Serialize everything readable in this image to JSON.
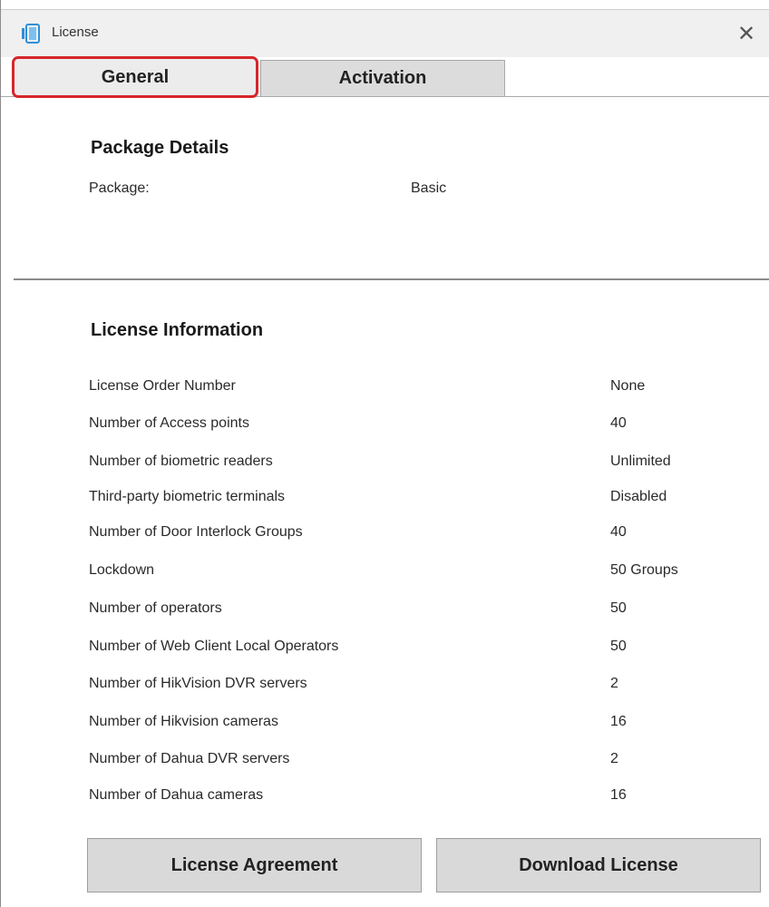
{
  "window": {
    "title": "License",
    "close_glyph": "✕"
  },
  "tabs": [
    {
      "label": "General",
      "selected": true
    },
    {
      "label": "Activation",
      "selected": false
    }
  ],
  "package": {
    "section_title": "Package Details",
    "package_label": "Package:",
    "package_value": "Basic"
  },
  "license": {
    "section_title": "License Information",
    "rows": [
      {
        "label": "License Order Number",
        "value": "None"
      },
      {
        "label": "Number of Access points",
        "value": "40"
      },
      {
        "label": "Number of biometric readers",
        "value": "Unlimited"
      },
      {
        "label": "Third-party biometric terminals",
        "value": "Disabled"
      },
      {
        "label": "Number of Door Interlock Groups",
        "value": "40"
      },
      {
        "label": "Lockdown",
        "value": "50 Groups"
      },
      {
        "label": "Number of operators",
        "value": "50"
      },
      {
        "label": "Number of Web Client Local Operators",
        "value": "50"
      },
      {
        "label": "Number of HikVision DVR servers",
        "value": "2"
      },
      {
        "label": "Number of Hikvision cameras",
        "value": "16"
      },
      {
        "label": "Number of Dahua DVR servers",
        "value": "2"
      },
      {
        "label": "Number of Dahua cameras",
        "value": "16"
      }
    ]
  },
  "buttons": {
    "agreement_label": "License Agreement",
    "download_label": "Download License"
  },
  "colors": {
    "highlight": "#d7262b",
    "app_icon": "#2f8fd8"
  },
  "icons": {
    "app": "license-app-icon",
    "close": "close-icon"
  }
}
